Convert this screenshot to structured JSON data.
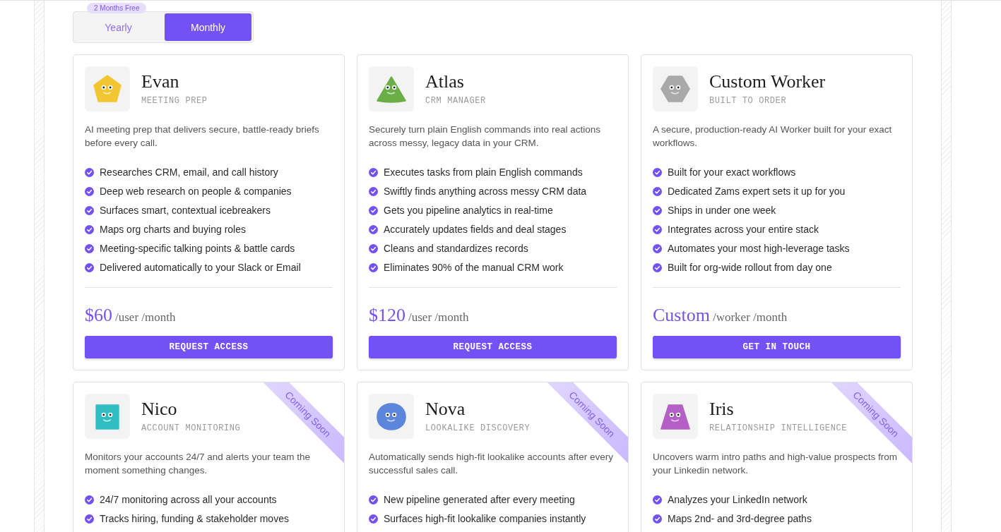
{
  "billing_toggle": {
    "badge": "2 Months Free",
    "options": [
      {
        "label": "Yearly",
        "selected": false
      },
      {
        "label": "Monthly",
        "selected": true
      }
    ]
  },
  "cards": [
    {
      "name": "Evan",
      "role": "MEETING PREP",
      "mascot": {
        "kind": "pentagon",
        "color": "#f2c630"
      },
      "description": "AI meeting prep that delivers secure, battle-ready briefs before every call.",
      "features": [
        "Researches CRM, email, and call history",
        "Deep web research on people & companies",
        "Surfaces smart, contextual icebreakers",
        "Maps org charts and buying roles",
        "Meeting-specific talking points & battle cards",
        "Delivered automatically to your Slack or Email"
      ],
      "price": {
        "amount": "$60",
        "unit": "/user /month"
      },
      "button": "REQUEST ACCESS"
    },
    {
      "name": "Atlas",
      "role": "CRM MANAGER",
      "mascot": {
        "kind": "triangle",
        "color": "#6aae48"
      },
      "description": "Securely turn plain English commands into real actions across messy, legacy data in your CRM.",
      "features": [
        "Executes tasks from plain English commands",
        "Swiftly finds anything across messy CRM data",
        "Gets you pipeline analytics in real-time",
        "Accurately updates fields and deal stages",
        "Cleans and standardizes records",
        "Eliminates 90% of the manual CRM work"
      ],
      "price": {
        "amount": "$120",
        "unit": "/user /month"
      },
      "button": "REQUEST ACCESS"
    },
    {
      "name": "Custom Worker",
      "role": "BUILT TO ORDER",
      "mascot": {
        "kind": "hexagon",
        "color": "#a9a9a9"
      },
      "description": "A secure, production-ready AI Worker built for your exact workflows.",
      "features": [
        "Built for your exact workflows",
        "Dedicated Zams expert sets it up for you",
        "Ships in under one week",
        "Integrates across your entire stack",
        "Automates your most high-leverage tasks",
        "Built for org-wide rollout from day one"
      ],
      "price": {
        "amount": "Custom",
        "unit": "/worker /month"
      },
      "button": "GET IN TOUCH"
    },
    {
      "name": "Nico",
      "role": "ACCOUNT MONITORING",
      "ribbon": "Coming Soon",
      "mascot": {
        "kind": "square",
        "color": "#2fbfc2"
      },
      "description": "Monitors your accounts 24/7 and alerts your team the moment something changes.",
      "features": [
        "24/7 monitoring across all your accounts",
        "Tracks hiring, funding & stakeholder moves"
      ]
    },
    {
      "name": "Nova",
      "role": "LOOKALIKE DISCOVERY",
      "ribbon": "Coming Soon",
      "mascot": {
        "kind": "circle",
        "color": "#5b86dc"
      },
      "description": "Automatically sends high-fit lookalike accounts after every successful sales call.",
      "features": [
        "New pipeline generated after every meeting",
        "Surfaces high-fit lookalike companies instantly"
      ]
    },
    {
      "name": "Iris",
      "role": "RELATIONSHIP INTELLIGENCE",
      "ribbon": "Coming Soon",
      "mascot": {
        "kind": "trapezoid",
        "color": "#b45fc6"
      },
      "description": "Uncovers warm intro paths and high-value prospects from your Linkedin network.",
      "features": [
        "Analyzes your LinkedIn network",
        "Maps 2nd- and 3rd-degree paths"
      ]
    }
  ]
}
